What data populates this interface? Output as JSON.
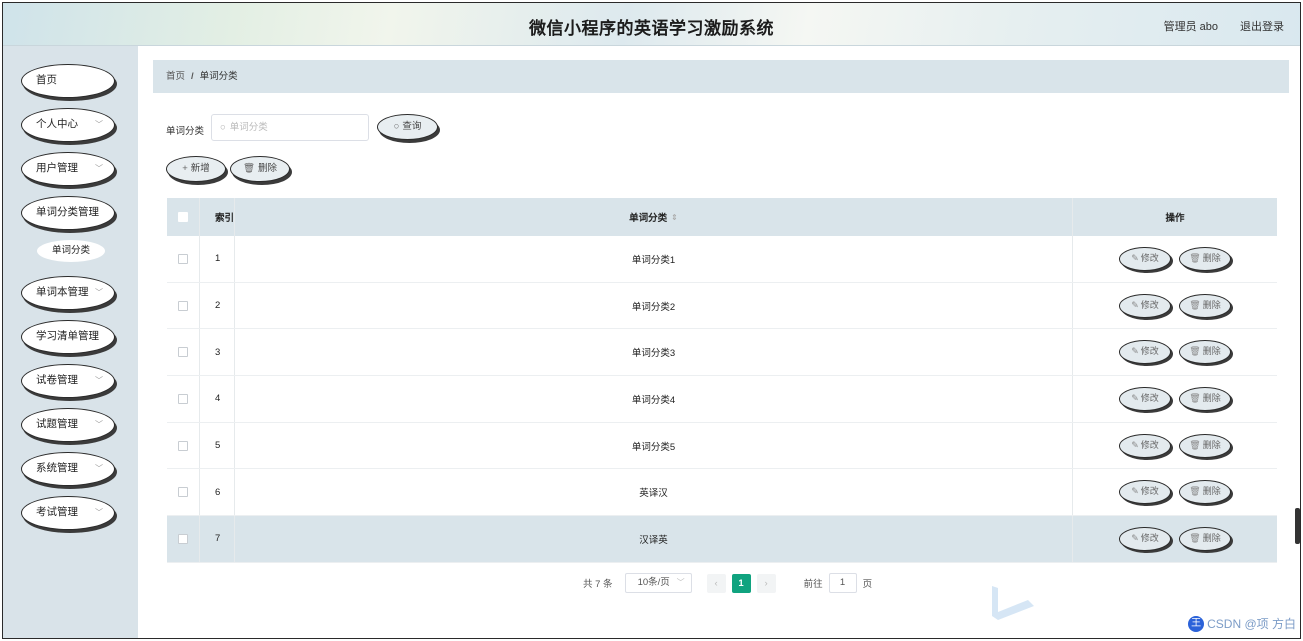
{
  "header": {
    "title": "微信小程序的英语学习激励系统",
    "user": "管理员 abo",
    "logout": "退出登录"
  },
  "sidebar": {
    "items": [
      {
        "label": "首页",
        "chevron": false
      },
      {
        "label": "个人中心",
        "chevron": true
      },
      {
        "label": "用户管理",
        "chevron": true
      },
      {
        "label": "单词分类管理",
        "chevron": false
      },
      {
        "label": "单词本管理",
        "chevron": true
      },
      {
        "label": "学习清单管理",
        "chevron": false
      },
      {
        "label": "试卷管理",
        "chevron": true
      },
      {
        "label": "试题管理",
        "chevron": true
      },
      {
        "label": "系统管理",
        "chevron": true
      },
      {
        "label": "考试管理",
        "chevron": true
      }
    ],
    "submenu": {
      "label": "单词分类"
    }
  },
  "breadcrumb": {
    "home": "首页",
    "separator": "/",
    "current": "单词分类"
  },
  "search": {
    "label": "单词分类",
    "placeholder": "单词分类",
    "button": "查询"
  },
  "actions": {
    "add": "新增",
    "delete": "删除"
  },
  "table": {
    "headers": {
      "index": "索引",
      "category": "单词分类",
      "operation": "操作"
    },
    "rows": [
      {
        "index": "1",
        "category": "单词分类1"
      },
      {
        "index": "2",
        "category": "单词分类2"
      },
      {
        "index": "3",
        "category": "单词分类3"
      },
      {
        "index": "4",
        "category": "单词分类4"
      },
      {
        "index": "5",
        "category": "单词分类5"
      },
      {
        "index": "6",
        "category": "英译汉"
      },
      {
        "index": "7",
        "category": "汉译英"
      }
    ],
    "row_actions": {
      "edit": "修改",
      "delete": "删除"
    }
  },
  "pagination": {
    "total": "共 7 条",
    "page_size": "10条/页",
    "current_page": "1",
    "goto_label": "前往",
    "goto_value": "1",
    "page_unit": "页",
    "prev": "‹",
    "next": "›"
  },
  "watermark": {
    "text": "CSDN @项 方白"
  },
  "colors": {
    "accent": "#10a37f",
    "sidebar_bg": "#d9e3e9",
    "header_row_bg": "#d9e4ea"
  }
}
